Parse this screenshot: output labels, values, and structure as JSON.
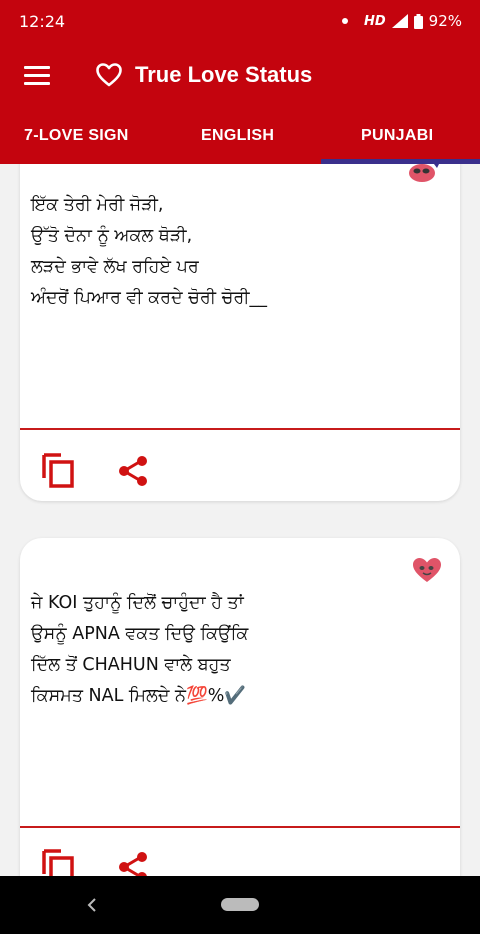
{
  "status_bar": {
    "time": "12:24",
    "network": "HD",
    "battery": "92%"
  },
  "app_bar": {
    "title": "True Love Status",
    "menu_icon": "hamburger-menu-icon",
    "logo_icon": "heart-outline-icon"
  },
  "tabs": [
    {
      "label": "7-LOVE SIGN"
    },
    {
      "label": "ENGLISH"
    },
    {
      "label": "PUNJABI",
      "selected": true
    }
  ],
  "cards": [
    {
      "lines": [
        "ਇੱਕ ਤੇਰੀ ਮੇਰੀ ਜੋੜੀ,",
        "ਉੱਤੋ ਦੋਨਾ ਨੂੰ ਅਕਲ ਥੋੜੀ,",
        "ਲੜਦੇ ਭਾਵੇ ਲੱਖ ਰਹਿਏ ਪਰ",
        "ਅੰਦਰੋਂ ਪਿਆਰ ਵੀ ਕਰਦੇ ਚੋਰੀ ਚੋਰੀ__"
      ]
    },
    {
      "lines": [
        "ਜੇ KOI ਤੁਹਾਨੂੰ ਦਿਲੋਂ ਚਾਹੁੰਦਾ ਹੈ ਤਾਂ",
        "ਉਸਨੂੰ APNA ਵਕਤ ਦਿਉ ਕਿਉਂਕਿ",
        "ਦਿੱਲ ਤੋਂ CHAHUN ਵਾਲੇ ਬਹੁਤ",
        "ਕਿਸਮਤ NAL ਮਿਲਦੇ ਨੇ💯%✔️"
      ]
    }
  ],
  "icons": {
    "copy": "copy-icon",
    "share": "share-icon",
    "sticker": "heart-sticker-icon"
  },
  "colors": {
    "primary": "#c4040e",
    "tab_indicator": "#3a2f8c",
    "divider": "#c71b1b",
    "icon_red": "#d01212"
  }
}
